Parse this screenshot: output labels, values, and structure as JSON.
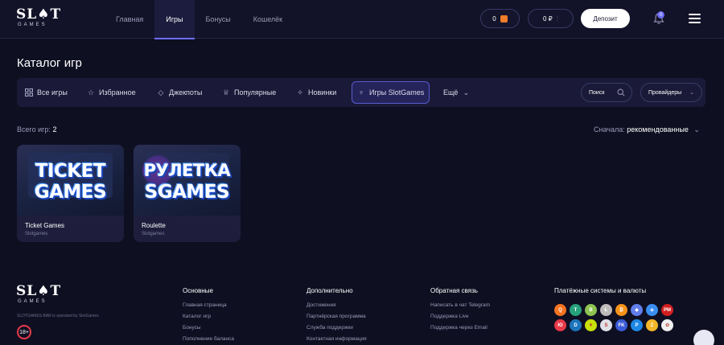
{
  "logo": {
    "top": "SL♠T",
    "bottom": "GAMES"
  },
  "nav": [
    {
      "label": "Главная",
      "active": false
    },
    {
      "label": "Игры",
      "active": true
    },
    {
      "label": "Бонусы",
      "active": false
    },
    {
      "label": "Кошелёк",
      "active": false
    }
  ],
  "header": {
    "bonus_balance": "0",
    "balance": "0 ₽",
    "deposit_label": "Депозит",
    "notifications_count": "0"
  },
  "catalog": {
    "title": "Каталог игр",
    "tabs": [
      {
        "label": "Все игры",
        "icon": "grid-icon"
      },
      {
        "label": "Избранное",
        "icon": "star-icon"
      },
      {
        "label": "Джекпоты",
        "icon": "diamond-icon"
      },
      {
        "label": "Популярные",
        "icon": "crown-icon"
      },
      {
        "label": "Новинки",
        "icon": "sparkle-icon"
      },
      {
        "label": "Игры SlotGames",
        "icon": "trophy-icon",
        "active": true
      },
      {
        "label": "Ещё",
        "icon": "chevron-down-icon"
      }
    ],
    "search_label": "Поиск",
    "providers_label": "Провайдеры",
    "total_label": "Всего игр:",
    "total_count": "2",
    "sort_label": "Сначала:",
    "sort_value": "рекомендованные"
  },
  "games": [
    {
      "name": "Ticket Games",
      "provider": "Slotgames",
      "art_line1": "TICKET",
      "art_line2": "GAMES"
    },
    {
      "name": "Roulette",
      "provider": "Slotgames",
      "art_line1": "РУЛЕТКА",
      "art_line2": "SGAMES"
    }
  ],
  "footer": {
    "operated": "SLOTGAMES.BAR is operated by SlotGames",
    "age": "18+",
    "columns": [
      {
        "title": "Основные",
        "links": [
          "Главная страница",
          "Каталог игр",
          "Бонусы",
          "Пополнение баланса"
        ]
      },
      {
        "title": "Дополнительно",
        "links": [
          "Достижения",
          "Партнёрская программа",
          "Служба поддержки",
          "Контактная информация"
        ]
      },
      {
        "title": "Обратная связь",
        "links": [
          "Написать в чат Telegram",
          "Поддержка Live",
          "Поддержка через Email"
        ]
      }
    ],
    "payments_title": "Платёжные системы и валюты",
    "payment_row1": [
      {
        "icon": "qiwi-icon",
        "color": "#f5731f",
        "glyph": "Q"
      },
      {
        "icon": "tether-icon",
        "color": "#26a17b",
        "glyph": "T"
      },
      {
        "icon": "bitcoin-cash-icon",
        "color": "#8dc351",
        "glyph": "B"
      },
      {
        "icon": "litecoin-icon",
        "color": "#bfbbbb",
        "glyph": "Ł"
      },
      {
        "icon": "bitcoin-icon",
        "color": "#f7931a",
        "glyph": "₿"
      },
      {
        "icon": "ethereum-icon",
        "color": "#627eea",
        "glyph": "◆"
      },
      {
        "icon": "ethereum-classic-icon",
        "color": "#3a8ef0",
        "glyph": "◈"
      },
      {
        "icon": "perfect-money-icon",
        "color": "#d01f1f",
        "glyph": "PM"
      }
    ],
    "payment_row2": [
      {
        "icon": "yoomoney-icon",
        "color": "#e8394a",
        "glyph": "Ю"
      },
      {
        "icon": "dash-icon",
        "color": "#1c75bc",
        "glyph": "D"
      },
      {
        "icon": "tron-icon",
        "color": "#c9e00a",
        "glyph": "▼"
      },
      {
        "icon": "skrill-icon",
        "color": "#e0e0e8",
        "glyph": "S"
      },
      {
        "icon": "fk-wallet-icon",
        "color": "#3b5cd8",
        "glyph": "FK"
      },
      {
        "icon": "payeer-icon",
        "color": "#1e88e5",
        "glyph": "P"
      },
      {
        "icon": "zcash-icon",
        "color": "#f4b728",
        "glyph": "Z"
      },
      {
        "icon": "piastrix-icon",
        "color": "#f0f0f0",
        "glyph": "✿"
      }
    ]
  }
}
